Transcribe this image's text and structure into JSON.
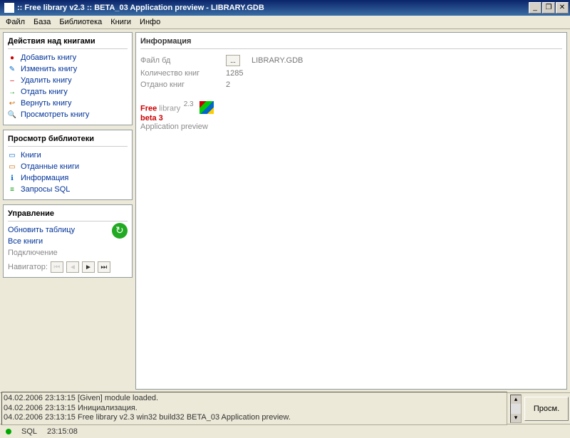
{
  "window": {
    "title": ":: Free library  v2.3 :: BETA_03 Application preview - LIBRARY.GDB",
    "min": "_",
    "restore": "❐",
    "close": "✕"
  },
  "menu": {
    "file": "Файл",
    "base": "База",
    "library": "Библиотека",
    "books": "Книги",
    "info": "Инфо"
  },
  "panel1": {
    "title": "Действия над книгами",
    "add": "Добавить книгу",
    "edit": "Изменить книгу",
    "delete": "Удалить книгу",
    "give": "Отдать книгу",
    "return": "Вернуть книгу",
    "view": "Просмотреть книгу"
  },
  "panel2": {
    "title": "Просмотр библиотеки",
    "books": "Книги",
    "given": "Отданные книги",
    "info": "Информация",
    "sql": "Запросы SQL"
  },
  "panel3": {
    "title": "Управление",
    "refresh": "Обновить таблицу",
    "allbooks": "Все книги",
    "connect": "Подключение",
    "nav": "Навигатор:",
    "first": "⏮",
    "prev": "◄",
    "next": "►",
    "last": "⏭"
  },
  "info": {
    "title": "Информация",
    "file_lbl": "Файл бд",
    "file_val": "LIBRARY.GDB",
    "count_lbl": "Количество книг",
    "count_val": "1285",
    "given_lbl": "Отдано книг",
    "given_val": "2",
    "browse": "..."
  },
  "logo": {
    "free": "Free",
    "lib": " library",
    "ver": "2.3",
    "beta": "beta 3",
    "sub": "Application preview"
  },
  "log": {
    "l1": "04.02.2006 23:13:15  [Given] module  loaded.",
    "l2": "04.02.2006 23:13:15  Инициализация.",
    "l3": "04.02.2006 23:13:15  Free library v2.3 win32 build32 BETA_03 Application preview."
  },
  "bottom_btn": "Просм.",
  "status": {
    "sql": "SQL",
    "time": "23:15:08"
  }
}
